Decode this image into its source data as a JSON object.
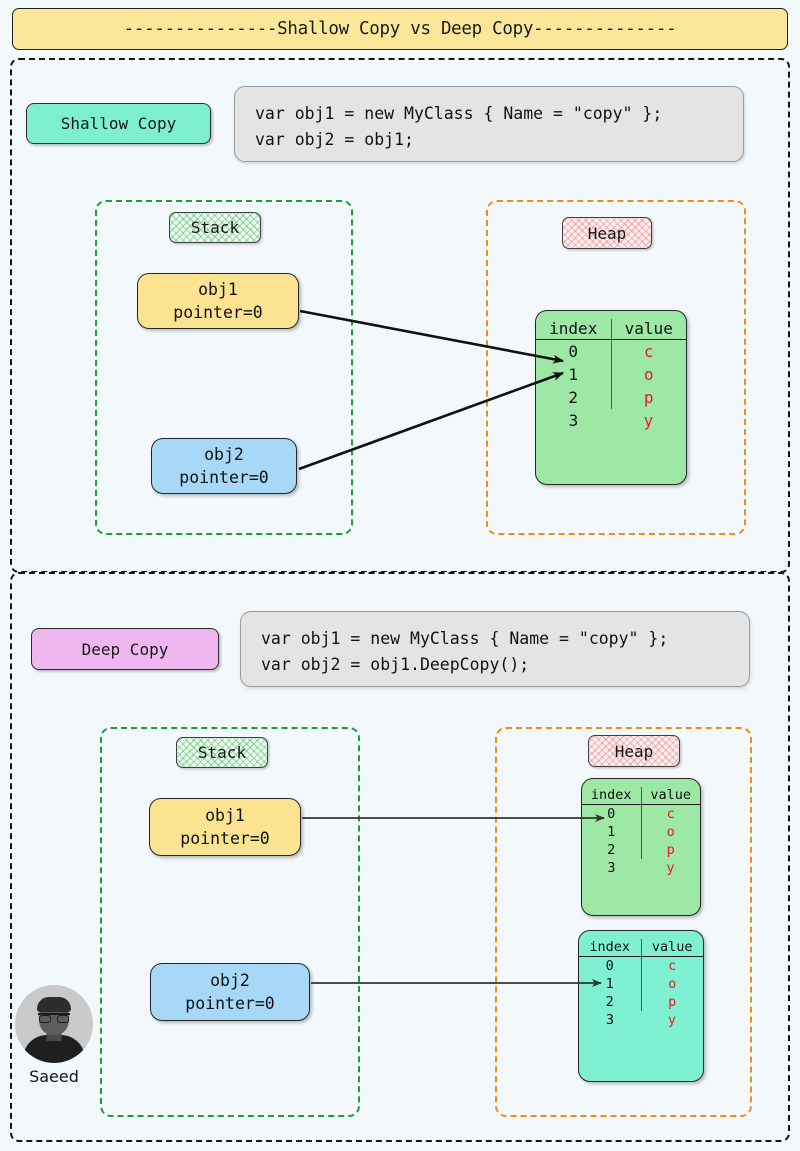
{
  "title": "---------------Shallow Copy vs Deep Copy--------------",
  "sections": [
    {
      "id": "shallow",
      "badge": "Shallow Copy",
      "code": "var obj1 = new MyClass { Name = \"copy\" };\nvar obj2 = obj1;",
      "stack": {
        "chip": "Stack",
        "vars": [
          {
            "name": "obj1",
            "pointer": "pointer=0"
          },
          {
            "name": "obj2",
            "pointer": "pointer=0"
          }
        ]
      },
      "heap": {
        "chip": "Heap",
        "blocks": [
          {
            "columns": [
              "index",
              "value"
            ],
            "rows": [
              [
                "0",
                "c"
              ],
              [
                "1",
                "o"
              ],
              [
                "2",
                "p"
              ],
              [
                "3",
                "y"
              ]
            ]
          }
        ]
      }
    },
    {
      "id": "deep",
      "badge": "Deep Copy",
      "code": "var obj1 = new MyClass { Name = \"copy\" };\nvar obj2 = obj1.DeepCopy();",
      "stack": {
        "chip": "Stack",
        "vars": [
          {
            "name": "obj1",
            "pointer": "pointer=0"
          },
          {
            "name": "obj2",
            "pointer": "pointer=0"
          }
        ]
      },
      "heap": {
        "chip": "Heap",
        "blocks": [
          {
            "columns": [
              "index",
              "value"
            ],
            "rows": [
              [
                "0",
                "c"
              ],
              [
                "1",
                "o"
              ],
              [
                "2",
                "p"
              ],
              [
                "3",
                "y"
              ]
            ]
          },
          {
            "columns": [
              "index",
              "value"
            ],
            "rows": [
              [
                "0",
                "c"
              ],
              [
                "1",
                "o"
              ],
              [
                "2",
                "p"
              ],
              [
                "3",
                "y"
              ]
            ]
          }
        ]
      }
    }
  ],
  "signature": {
    "name": "Saeed"
  },
  "colors": {
    "title_bg": "#fbe79a",
    "shallow_badge_bg": "#7ef0cd",
    "deep_badge_bg": "#efb6f0",
    "stack_border": "#1d9c3a",
    "heap_border": "#f08c18",
    "obj1_bg": "#fbe392",
    "obj2_bg": "#a8d8f8",
    "heap_block_1_bg": "#9ce8a4",
    "heap_block_2_bg": "#7ff0d2",
    "value_text": "#e81c1c"
  }
}
